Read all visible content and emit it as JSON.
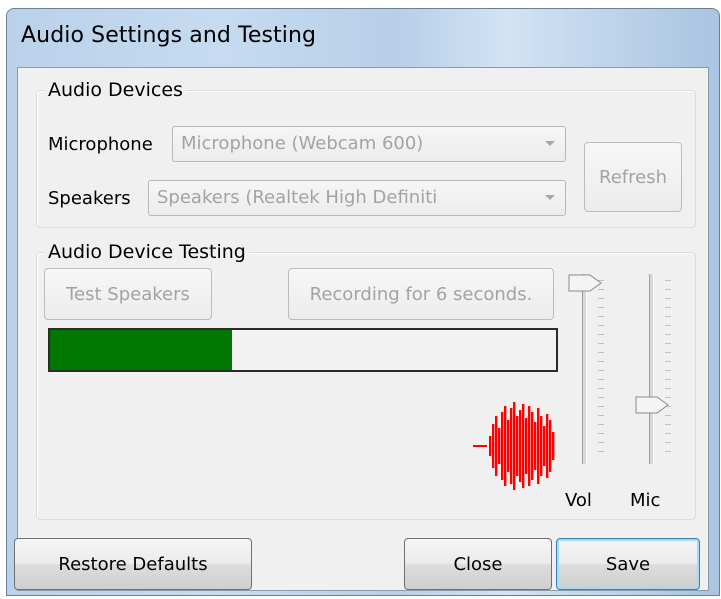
{
  "window": {
    "title": "Audio Settings and Testing"
  },
  "audio_devices": {
    "group_label": "Audio Devices",
    "microphone_label": "Microphone",
    "microphone_value": "Microphone (Webcam 600)",
    "speakers_label": "Speakers",
    "speakers_value": "Speakers (Realtek High Definiti",
    "refresh_label": "Refresh"
  },
  "testing": {
    "group_label": "Audio Device Testing",
    "test_speakers_label": "Test Speakers",
    "recording_label": "Recording for 6 seconds.",
    "level_fraction": 0.36,
    "level_color": "#007700",
    "waveform_color": "#ff0000",
    "vol_label": "Vol",
    "mic_label": "Mic",
    "vol_level": 1.0,
    "mic_level": 0.29
  },
  "footer": {
    "restore_defaults_label": "Restore Defaults",
    "close_label": "Close",
    "save_label": "Save"
  }
}
